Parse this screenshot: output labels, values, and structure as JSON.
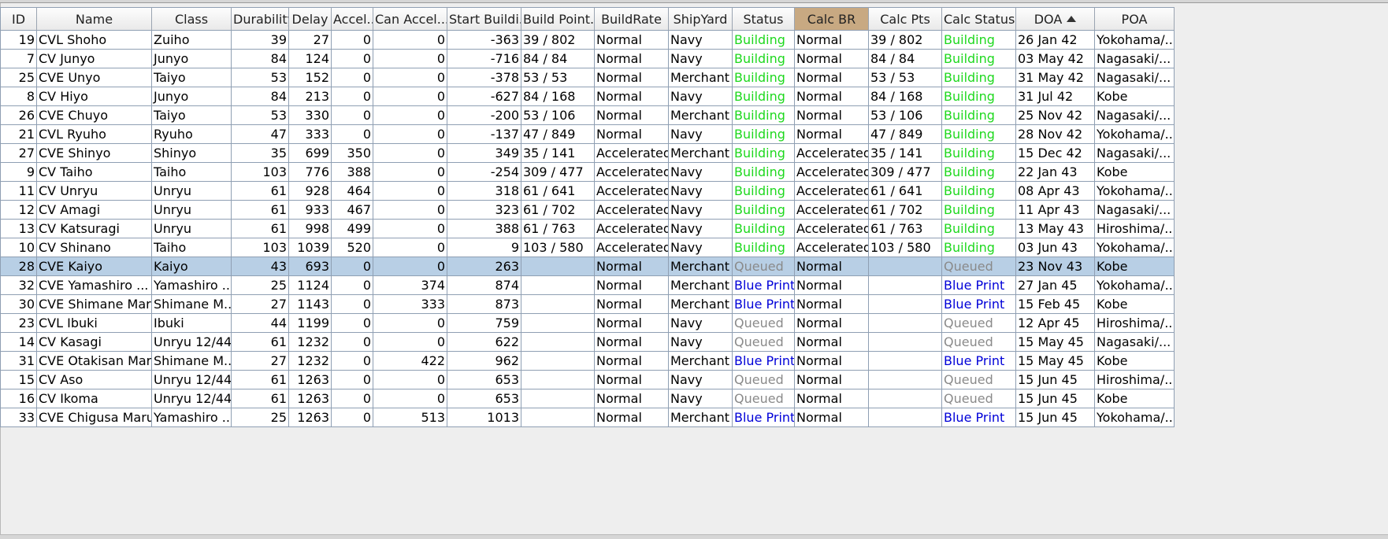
{
  "columns": [
    {
      "key": "id",
      "label": "ID",
      "align": "right"
    },
    {
      "key": "name",
      "label": "Name",
      "align": "left"
    },
    {
      "key": "class",
      "label": "Class",
      "align": "left"
    },
    {
      "key": "durability",
      "label": "Durability",
      "align": "right"
    },
    {
      "key": "delay",
      "label": "Delay",
      "align": "right"
    },
    {
      "key": "accel",
      "label": "Accel...",
      "align": "right"
    },
    {
      "key": "can_accel",
      "label": "Can Accel...",
      "align": "right"
    },
    {
      "key": "start_build",
      "label": "Start Buildi...",
      "align": "right"
    },
    {
      "key": "build_points",
      "label": "Build Point...",
      "align": "left"
    },
    {
      "key": "build_rate",
      "label": "BuildRate",
      "align": "left"
    },
    {
      "key": "shipyard",
      "label": "ShipYard",
      "align": "left"
    },
    {
      "key": "status",
      "label": "Status",
      "align": "left"
    },
    {
      "key": "calc_br",
      "label": "Calc BR",
      "align": "left"
    },
    {
      "key": "calc_pts",
      "label": "Calc Pts",
      "align": "left"
    },
    {
      "key": "calc_status",
      "label": "Calc Status",
      "align": "left"
    },
    {
      "key": "doa",
      "label": "DOA",
      "align": "left"
    },
    {
      "key": "poa",
      "label": "POA",
      "align": "left"
    }
  ],
  "sorted_column": "doa",
  "highlighted_column": "calc_br",
  "colors": {
    "building": "#1ed81e",
    "queued": "#8a8a8a",
    "blue_print": "#0000d8",
    "selected_row": "#b8cfe5",
    "highlight_header": "#c8a982"
  },
  "rows": [
    {
      "id": "19",
      "name": "CVL Shoho",
      "class": "Zuiho",
      "durability": "39",
      "delay": "27",
      "accel": "0",
      "can_accel": "0",
      "start_build": "-363",
      "build_points": "39 / 802",
      "build_rate": "Normal",
      "shipyard": "Navy",
      "status": "Building",
      "calc_br": "Normal",
      "calc_pts": "39 / 802",
      "calc_status": "Building",
      "doa": "26 Jan 42",
      "poa": "Yokohama/..."
    },
    {
      "id": "7",
      "name": "CV Junyo",
      "class": "Junyo",
      "durability": "84",
      "delay": "124",
      "accel": "0",
      "can_accel": "0",
      "start_build": "-716",
      "build_points": "84 / 84",
      "build_rate": "Normal",
      "shipyard": "Navy",
      "status": "Building",
      "calc_br": "Normal",
      "calc_pts": "84 / 84",
      "calc_status": "Building",
      "doa": "03 May 42",
      "poa": "Nagasaki/..."
    },
    {
      "id": "25",
      "name": "CVE Unyo",
      "class": "Taiyo",
      "durability": "53",
      "delay": "152",
      "accel": "0",
      "can_accel": "0",
      "start_build": "-378",
      "build_points": "53 / 53",
      "build_rate": "Normal",
      "shipyard": "Merchant",
      "status": "Building",
      "calc_br": "Normal",
      "calc_pts": "53 / 53",
      "calc_status": "Building",
      "doa": "31 May 42",
      "poa": "Nagasaki/..."
    },
    {
      "id": "8",
      "name": "CV Hiyo",
      "class": "Junyo",
      "durability": "84",
      "delay": "213",
      "accel": "0",
      "can_accel": "0",
      "start_build": "-627",
      "build_points": "84 / 168",
      "build_rate": "Normal",
      "shipyard": "Navy",
      "status": "Building",
      "calc_br": "Normal",
      "calc_pts": "84 / 168",
      "calc_status": "Building",
      "doa": "31 Jul 42",
      "poa": "Kobe"
    },
    {
      "id": "26",
      "name": "CVE Chuyo",
      "class": "Taiyo",
      "durability": "53",
      "delay": "330",
      "accel": "0",
      "can_accel": "0",
      "start_build": "-200",
      "build_points": "53 / 106",
      "build_rate": "Normal",
      "shipyard": "Merchant",
      "status": "Building",
      "calc_br": "Normal",
      "calc_pts": "53 / 106",
      "calc_status": "Building",
      "doa": "25 Nov 42",
      "poa": "Nagasaki/..."
    },
    {
      "id": "21",
      "name": "CVL Ryuho",
      "class": "Ryuho",
      "durability": "47",
      "delay": "333",
      "accel": "0",
      "can_accel": "0",
      "start_build": "-137",
      "build_points": "47 / 849",
      "build_rate": "Normal",
      "shipyard": "Navy",
      "status": "Building",
      "calc_br": "Normal",
      "calc_pts": "47 / 849",
      "calc_status": "Building",
      "doa": "28 Nov 42",
      "poa": "Yokohama/..."
    },
    {
      "id": "27",
      "name": "CVE Shinyo",
      "class": "Shinyo",
      "durability": "35",
      "delay": "699",
      "accel": "350",
      "can_accel": "0",
      "start_build": "349",
      "build_points": "35 / 141",
      "build_rate": "Accelerated",
      "shipyard": "Merchant",
      "status": "Building",
      "calc_br": "Accelerated",
      "calc_pts": "35 / 141",
      "calc_status": "Building",
      "doa": "15 Dec 42",
      "poa": "Nagasaki/..."
    },
    {
      "id": "9",
      "name": "CV Taiho",
      "class": "Taiho",
      "durability": "103",
      "delay": "776",
      "accel": "388",
      "can_accel": "0",
      "start_build": "-254",
      "build_points": "309 / 477",
      "build_rate": "Accelerated",
      "shipyard": "Navy",
      "status": "Building",
      "calc_br": "Accelerated",
      "calc_pts": "309 / 477",
      "calc_status": "Building",
      "doa": "22 Jan 43",
      "poa": "Kobe"
    },
    {
      "id": "11",
      "name": "CV Unryu",
      "class": "Unryu",
      "durability": "61",
      "delay": "928",
      "accel": "464",
      "can_accel": "0",
      "start_build": "318",
      "build_points": "61 / 641",
      "build_rate": "Accelerated",
      "shipyard": "Navy",
      "status": "Building",
      "calc_br": "Accelerated",
      "calc_pts": "61 / 641",
      "calc_status": "Building",
      "doa": "08 Apr 43",
      "poa": "Yokohama/..."
    },
    {
      "id": "12",
      "name": "CV Amagi",
      "class": "Unryu",
      "durability": "61",
      "delay": "933",
      "accel": "467",
      "can_accel": "0",
      "start_build": "323",
      "build_points": "61 / 702",
      "build_rate": "Accelerated",
      "shipyard": "Navy",
      "status": "Building",
      "calc_br": "Accelerated",
      "calc_pts": "61 / 702",
      "calc_status": "Building",
      "doa": "11 Apr 43",
      "poa": "Nagasaki/..."
    },
    {
      "id": "13",
      "name": "CV Katsuragi",
      "class": "Unryu",
      "durability": "61",
      "delay": "998",
      "accel": "499",
      "can_accel": "0",
      "start_build": "388",
      "build_points": "61 / 763",
      "build_rate": "Accelerated",
      "shipyard": "Navy",
      "status": "Building",
      "calc_br": "Accelerated",
      "calc_pts": "61 / 763",
      "calc_status": "Building",
      "doa": "13 May 43",
      "poa": "Hiroshima/..."
    },
    {
      "id": "10",
      "name": "CV Shinano",
      "class": "Taiho",
      "durability": "103",
      "delay": "1039",
      "accel": "520",
      "can_accel": "0",
      "start_build": "9",
      "build_points": "103 / 580",
      "build_rate": "Accelerated",
      "shipyard": "Navy",
      "status": "Building",
      "calc_br": "Accelerated",
      "calc_pts": "103 / 580",
      "calc_status": "Building",
      "doa": "03 Jun 43",
      "poa": "Yokohama/..."
    },
    {
      "id": "28",
      "name": "CVE Kaiyo",
      "class": "Kaiyo",
      "durability": "43",
      "delay": "693",
      "accel": "0",
      "can_accel": "0",
      "start_build": "263",
      "build_points": "",
      "build_rate": "Normal",
      "shipyard": "Merchant",
      "status": "Queued",
      "calc_br": "Normal",
      "calc_pts": "",
      "calc_status": "Queued",
      "doa": "23 Nov 43",
      "poa": "Kobe",
      "selected": true
    },
    {
      "id": "32",
      "name": "CVE Yamashiro ...",
      "class": "Yamashiro ...",
      "durability": "25",
      "delay": "1124",
      "accel": "0",
      "can_accel": "374",
      "start_build": "874",
      "build_points": "",
      "build_rate": "Normal",
      "shipyard": "Merchant",
      "status": "Blue Print",
      "calc_br": "Normal",
      "calc_pts": "",
      "calc_status": "Blue Print",
      "doa": "27 Jan 45",
      "poa": "Yokohama/..."
    },
    {
      "id": "30",
      "name": "CVE Shimane Maru",
      "class": "Shimane M...",
      "durability": "27",
      "delay": "1143",
      "accel": "0",
      "can_accel": "333",
      "start_build": "873",
      "build_points": "",
      "build_rate": "Normal",
      "shipyard": "Merchant",
      "status": "Blue Print",
      "calc_br": "Normal",
      "calc_pts": "",
      "calc_status": "Blue Print",
      "doa": "15 Feb 45",
      "poa": "Kobe"
    },
    {
      "id": "23",
      "name": "CVL Ibuki",
      "class": "Ibuki",
      "durability": "44",
      "delay": "1199",
      "accel": "0",
      "can_accel": "0",
      "start_build": "759",
      "build_points": "",
      "build_rate": "Normal",
      "shipyard": "Navy",
      "status": "Queued",
      "calc_br": "Normal",
      "calc_pts": "",
      "calc_status": "Queued",
      "doa": "12 Apr 45",
      "poa": "Hiroshima/..."
    },
    {
      "id": "14",
      "name": "CV Kasagi",
      "class": "Unryu 12/44",
      "durability": "61",
      "delay": "1232",
      "accel": "0",
      "can_accel": "0",
      "start_build": "622",
      "build_points": "",
      "build_rate": "Normal",
      "shipyard": "Navy",
      "status": "Queued",
      "calc_br": "Normal",
      "calc_pts": "",
      "calc_status": "Queued",
      "doa": "15 May 45",
      "poa": "Nagasaki/..."
    },
    {
      "id": "31",
      "name": "CVE Otakisan Maru",
      "class": "Shimane M...",
      "durability": "27",
      "delay": "1232",
      "accel": "0",
      "can_accel": "422",
      "start_build": "962",
      "build_points": "",
      "build_rate": "Normal",
      "shipyard": "Merchant",
      "status": "Blue Print",
      "calc_br": "Normal",
      "calc_pts": "",
      "calc_status": "Blue Print",
      "doa": "15 May 45",
      "poa": "Kobe"
    },
    {
      "id": "15",
      "name": "CV Aso",
      "class": "Unryu 12/44",
      "durability": "61",
      "delay": "1263",
      "accel": "0",
      "can_accel": "0",
      "start_build": "653",
      "build_points": "",
      "build_rate": "Normal",
      "shipyard": "Navy",
      "status": "Queued",
      "calc_br": "Normal",
      "calc_pts": "",
      "calc_status": "Queued",
      "doa": "15 Jun 45",
      "poa": "Hiroshima/..."
    },
    {
      "id": "16",
      "name": "CV Ikoma",
      "class": "Unryu 12/44",
      "durability": "61",
      "delay": "1263",
      "accel": "0",
      "can_accel": "0",
      "start_build": "653",
      "build_points": "",
      "build_rate": "Normal",
      "shipyard": "Navy",
      "status": "Queued",
      "calc_br": "Normal",
      "calc_pts": "",
      "calc_status": "Queued",
      "doa": "15 Jun 45",
      "poa": "Kobe"
    },
    {
      "id": "33",
      "name": "CVE Chigusa Maru",
      "class": "Yamashiro ...",
      "durability": "25",
      "delay": "1263",
      "accel": "0",
      "can_accel": "513",
      "start_build": "1013",
      "build_points": "",
      "build_rate": "Normal",
      "shipyard": "Merchant",
      "status": "Blue Print",
      "calc_br": "Normal",
      "calc_pts": "",
      "calc_status": "Blue Print",
      "doa": "15 Jun 45",
      "poa": "Yokohama/..."
    }
  ]
}
